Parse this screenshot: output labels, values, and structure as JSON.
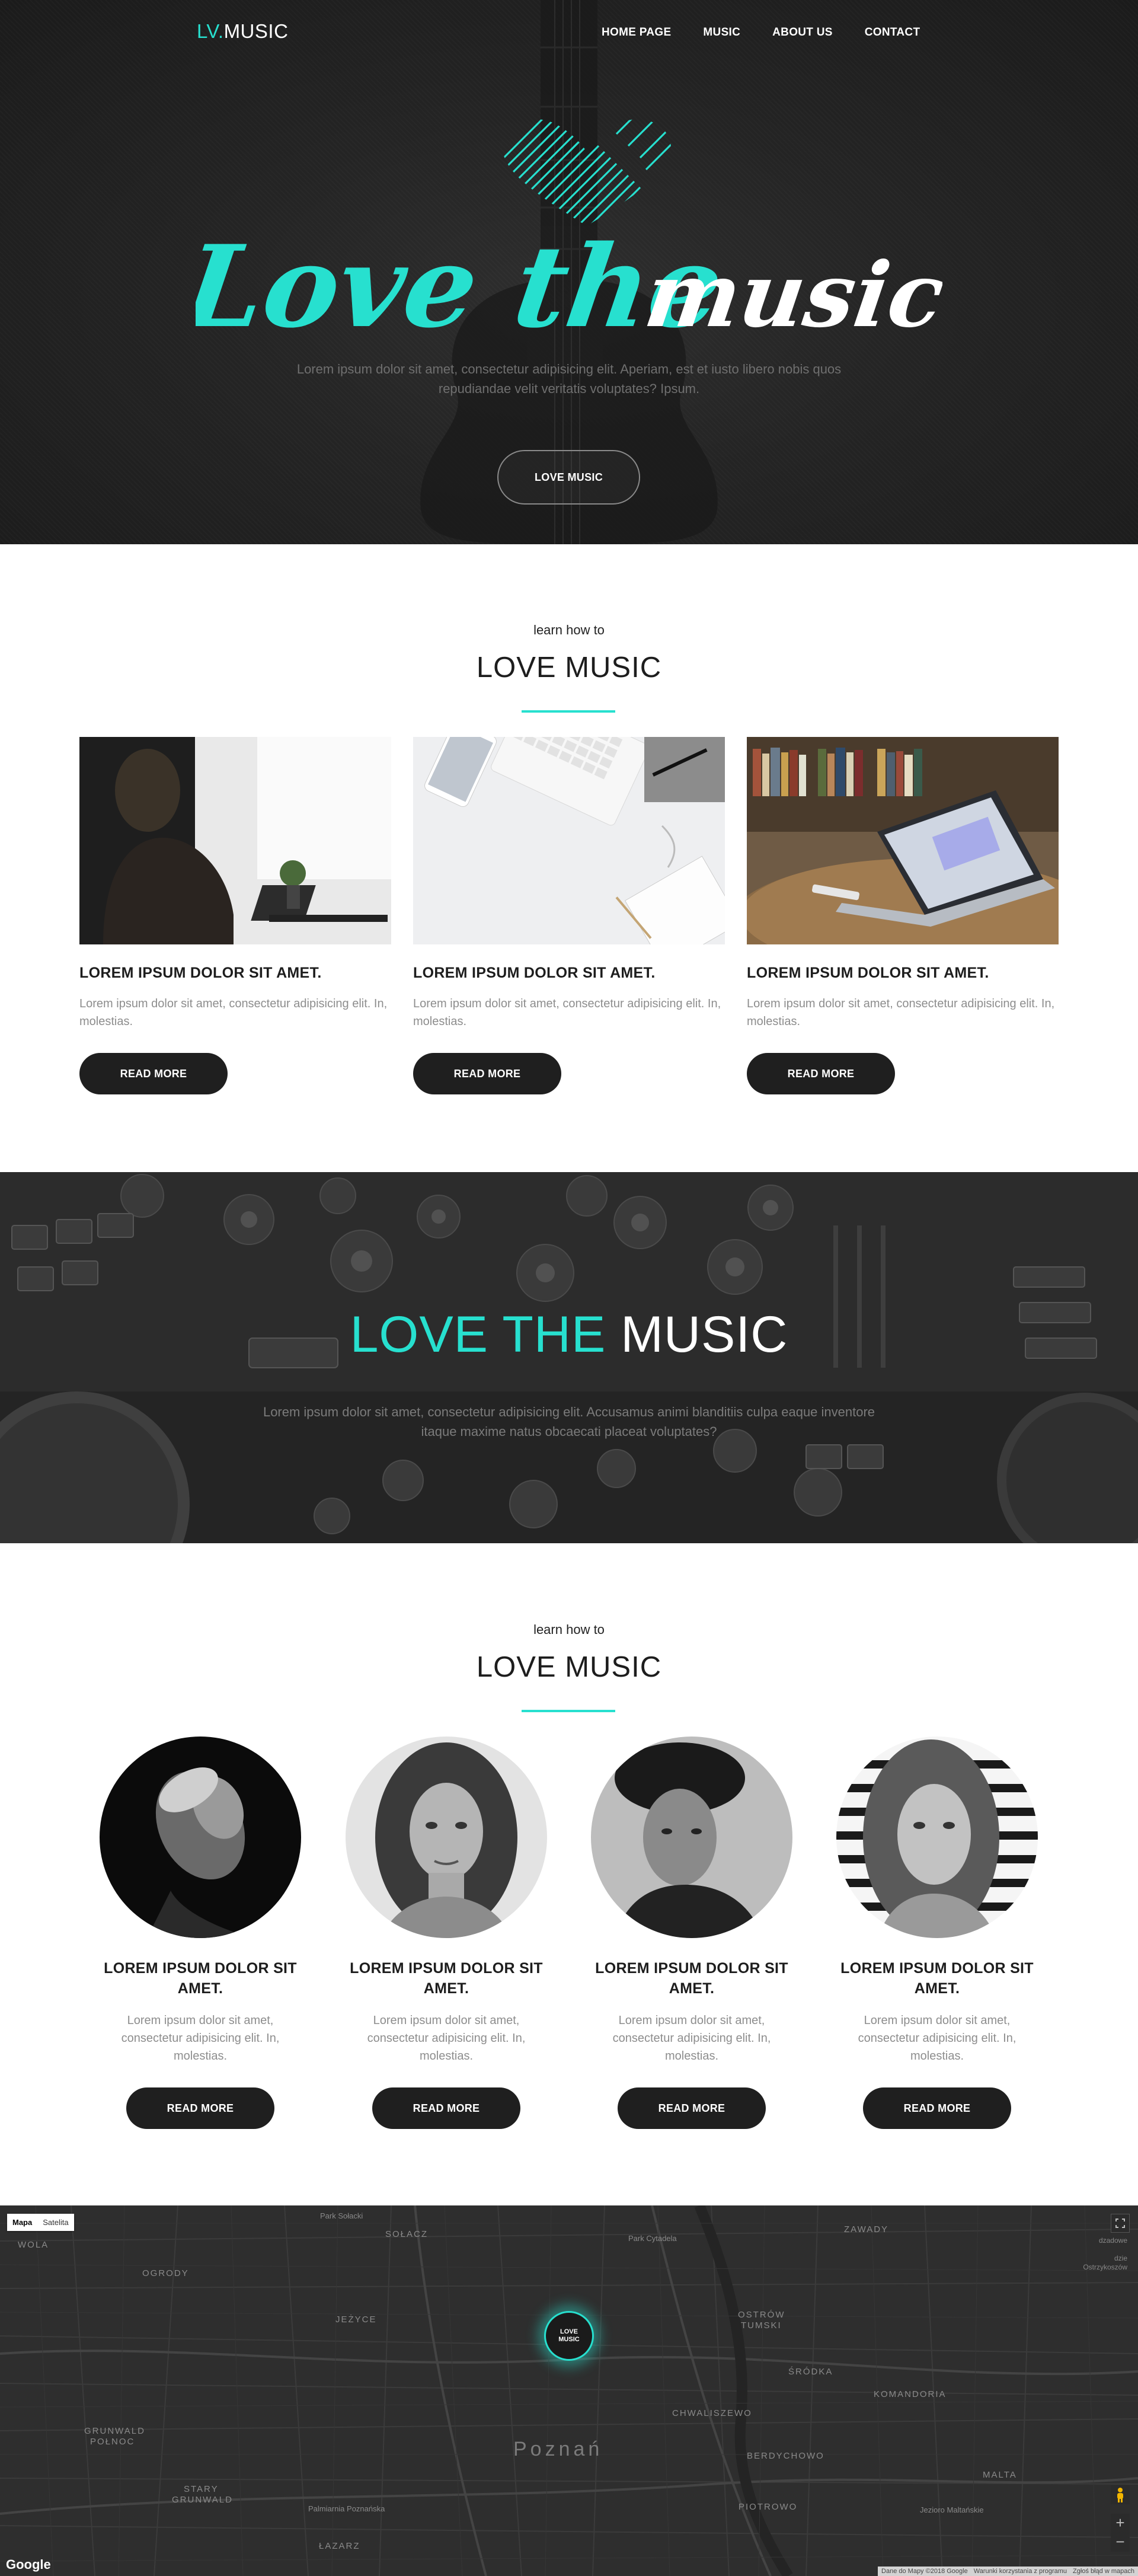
{
  "brand": {
    "logo_accent": "LV.",
    "logo_rest": "MUSIC",
    "accent_color": "#27e0cf"
  },
  "nav": {
    "items": [
      {
        "label": "HOME PAGE"
      },
      {
        "label": "MUSIC"
      },
      {
        "label": "ABOUT US"
      },
      {
        "label": "CONTACT"
      }
    ]
  },
  "hero": {
    "title_part1": "Love the",
    "title_part2": "music",
    "description": "Lorem ipsum dolor sit amet, consectetur adipisicing elit. Aperiam, est et iusto libero nobis quos repudiandae velit veritatis voluptates? Ipsum.",
    "button_label": "LOVE MUSIC"
  },
  "section1": {
    "kicker": "learn how to",
    "title": "LOVE MUSIC",
    "cards": [
      {
        "title": "LOREM IPSUM DOLOR SIT AMET.",
        "text": "Lorem ipsum dolor sit amet, consectetur adipisicing elit. In, molestias.",
        "button": "READ MORE"
      },
      {
        "title": "LOREM IPSUM DOLOR SIT AMET.",
        "text": "Lorem ipsum dolor sit amet, consectetur adipisicing elit. In, molestias.",
        "button": "READ MORE"
      },
      {
        "title": "LOREM IPSUM DOLOR SIT AMET.",
        "text": "Lorem ipsum dolor sit amet, consectetur adipisicing elit. In, molestias.",
        "button": "READ MORE"
      }
    ]
  },
  "banner": {
    "title_accent": "LOVE THE",
    "title_rest": "MUSIC",
    "description": "Lorem ipsum dolor sit amet, consectetur adipisicing elit. Accusamus animi blanditiis culpa eaque inventore itaque maxime natus obcaecati placeat voluptates?"
  },
  "section2": {
    "kicker": "learn how to",
    "title": "LOVE MUSIC",
    "members": [
      {
        "title": "LOREM IPSUM DOLOR SIT AMET.",
        "text": "Lorem ipsum dolor sit amet, consectetur adipisicing elit. In, molestias.",
        "button": "READ MORE"
      },
      {
        "title": "LOREM IPSUM DOLOR SIT AMET.",
        "text": "Lorem ipsum dolor sit amet, consectetur adipisicing elit. In, molestias.",
        "button": "READ MORE"
      },
      {
        "title": "LOREM IPSUM DOLOR SIT AMET.",
        "text": "Lorem ipsum dolor sit amet, consectetur adipisicing elit. In, molestias.",
        "button": "READ MORE"
      },
      {
        "title": "LOREM IPSUM DOLOR SIT AMET.",
        "text": "Lorem ipsum dolor sit amet, consectetur adipisicing elit. In, molestias.",
        "button": "READ MORE"
      }
    ]
  },
  "map": {
    "type_map": "Mapa",
    "type_satellite": "Satelita",
    "marker_line1": "LOVE",
    "marker_line2": "MUSIC",
    "labels": {
      "wola": "WOLA",
      "solacz": "SOŁACZ",
      "park_solacki": "Park Sołacki",
      "ogrody": "OGRODY",
      "jezyce": "JEŻYCE",
      "park_cytadela": "Park Cytadela",
      "zawady": "ZAWADY",
      "ostrow": "OSTRÓW",
      "tumski": "TUMSKI",
      "srodka": "ŚRÓDKA",
      "komandoria": "KOMANDORIA",
      "chwaliszewo": "CHWALISZEWO",
      "grunwald1": "GRUNWALD",
      "grunwald2": "POŁNOC",
      "poznan": "Poznań",
      "berdychowo": "BERDYCHOWO",
      "stary1": "STARY",
      "stary2": "GRUNWALD",
      "piotrowo": "PIOTROWO",
      "lazarz": "ŁAZARZ",
      "malta": "MALTA",
      "palmiarnia": "Palmiarnia Poznańska",
      "jezioro": "Jezioro Maltańskie"
    },
    "right_text": "dzadowe\n\ndzie\nOstrzykoszów",
    "google": "Google",
    "attribution": [
      "Dane do Mapy ©2018 Google",
      "Warunki korzystania z programu",
      "Zgłoś błąd w mapach"
    ],
    "zoom_in": "+",
    "zoom_out": "−"
  }
}
